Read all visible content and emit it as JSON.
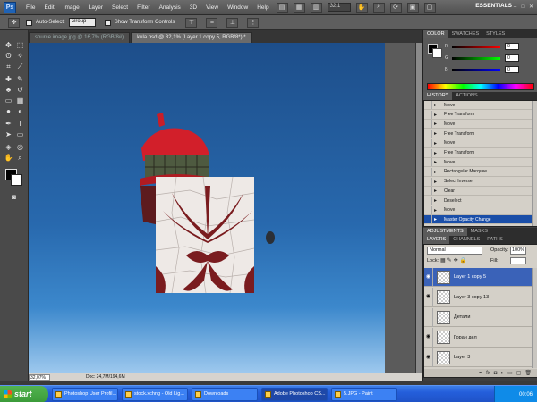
{
  "app": {
    "logo_text": "Ps",
    "essentials": "ESSENTIALS"
  },
  "menu": [
    "File",
    "Edit",
    "Image",
    "Layer",
    "Select",
    "Filter",
    "Analysis",
    "3D",
    "View",
    "Window",
    "Help"
  ],
  "zoom_field": "32,1",
  "options": {
    "auto_select_label": "Auto-Select:",
    "group_value": "Group",
    "show_transform_label": "Show Transform Controls"
  },
  "doc_tabs": [
    {
      "label": "source image.jpg @ 16,7% (RGB/8#)",
      "active": false
    },
    {
      "label": "kula.psd @ 32,1% (Layer 1 copy 5, RGB/8*) *",
      "active": true
    }
  ],
  "status": {
    "zoom": "32,07%",
    "doc": "Doc: 24,7M/194,6M"
  },
  "color_panel": {
    "tabs": [
      "COLOR",
      "SWATCHES",
      "STYLES"
    ],
    "rows": [
      {
        "label": "R",
        "value": "0"
      },
      {
        "label": "G",
        "value": "0"
      },
      {
        "label": "B",
        "value": "0"
      }
    ]
  },
  "history_panel": {
    "tabs": [
      "HISTORY",
      "ACTIONS"
    ],
    "items": [
      "Move",
      "Free Transform",
      "Move",
      "Free Transform",
      "Move",
      "Free Transform",
      "Move",
      "Rectangular Marquee",
      "Select Inverse",
      "Clear",
      "Deselect",
      "Move",
      "Master Opacity Change"
    ],
    "selected_index": 12
  },
  "adjust_tabs": [
    "ADJUSTMENTS",
    "MASKS"
  ],
  "layers_panel": {
    "tabs": [
      "LAYERS",
      "CHANNELS",
      "PATHS"
    ],
    "blend_mode": "Normal",
    "opacity_label": "Opacity:",
    "opacity": "100%",
    "lock_label": "Lock:",
    "fill_label": "Fill:",
    "layers": [
      {
        "name": "Layer 1 copy 5",
        "visible": true,
        "selected": true
      },
      {
        "name": "Layer 3 copy 13",
        "visible": true,
        "selected": false
      },
      {
        "name": "Детали",
        "visible": false,
        "selected": false
      },
      {
        "name": "Горан дел",
        "visible": true,
        "selected": false
      },
      {
        "name": "Layer 3",
        "visible": true,
        "selected": false
      }
    ]
  },
  "taskbar": {
    "start_label": "start",
    "items": [
      {
        "label": "Photoshop User Profil...",
        "active": false
      },
      {
        "label": "stock.xchng - Old Lig...",
        "active": false
      },
      {
        "label": "Downloads",
        "active": false
      },
      {
        "label": "Adobe Photoshop CS...",
        "active": true
      },
      {
        "label": "5.JPG - Paint",
        "active": false
      }
    ],
    "clock": "00:06"
  }
}
